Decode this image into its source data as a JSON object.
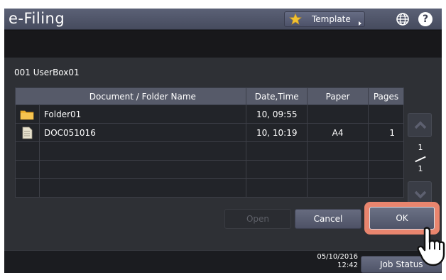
{
  "titlebar": {
    "app_title": "e-Filing",
    "template_label": "Template",
    "icons": {
      "star": "star-icon",
      "globe": "globe-icon",
      "help": "help-icon"
    },
    "help_glyph": "?"
  },
  "box": {
    "title": "001 UserBox01"
  },
  "table": {
    "headers": [
      "Document / Folder Name",
      "Date,Time",
      "Paper",
      "Pages"
    ],
    "rows": [
      {
        "type": "folder",
        "icon": "folder-icon",
        "name": "Folder01",
        "date": "10, 09:55",
        "paper": "",
        "pages": ""
      },
      {
        "type": "document",
        "icon": "document-icon",
        "name": "DOC051016",
        "date": "10, 10:19",
        "paper": "A4",
        "pages": "1"
      }
    ]
  },
  "pager": {
    "current": "1",
    "total": "1",
    "icons": {
      "up": "chevron-up-icon",
      "down": "chevron-down-icon"
    }
  },
  "actions": {
    "open": "Open",
    "cancel": "Cancel",
    "ok": "OK"
  },
  "status": {
    "date": "05/10/2016",
    "time": "12:42",
    "job_status": "Job Status"
  },
  "colors": {
    "highlight": "#e9856e",
    "titlebar": "#4f5468",
    "folder": "#f2b632"
  }
}
